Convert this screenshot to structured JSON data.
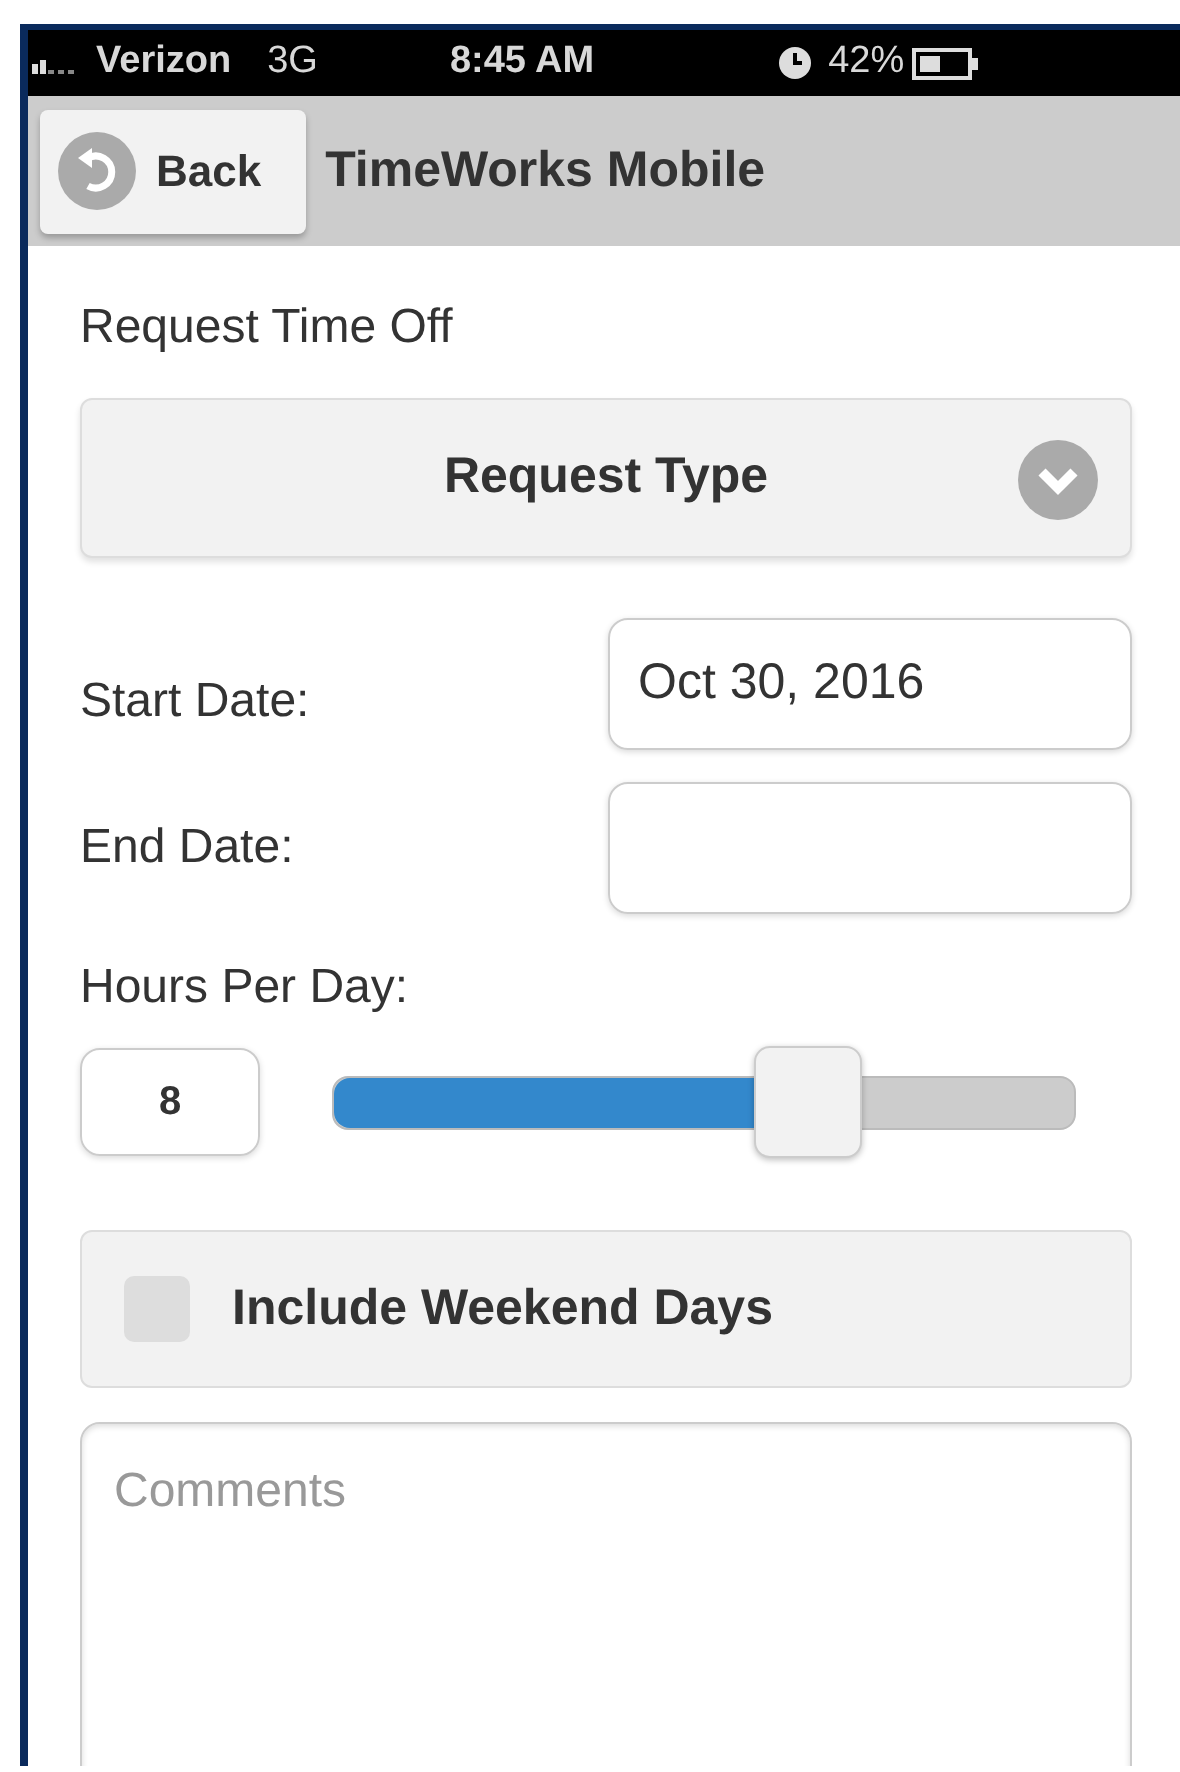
{
  "status_bar": {
    "carrier": "Verizon",
    "network": "3G",
    "time": "8:45 AM",
    "battery": "42%"
  },
  "header": {
    "back_button": "Back",
    "title": "TimeWorks Mobile"
  },
  "form": {
    "heading": "Request Time Off",
    "request_type": {
      "label": "Request Type"
    },
    "start_date": {
      "label": "Start Date:",
      "value": "Oct 30, 2016"
    },
    "end_date": {
      "label": "End Date:"
    },
    "hours_per_day": {
      "label": "Hours Per Day:",
      "value": "8",
      "level": 0.64
    },
    "include_weekend": {
      "label": "Include Weekend Days",
      "checked": false
    },
    "comments": {
      "placeholder": "Comments"
    }
  }
}
